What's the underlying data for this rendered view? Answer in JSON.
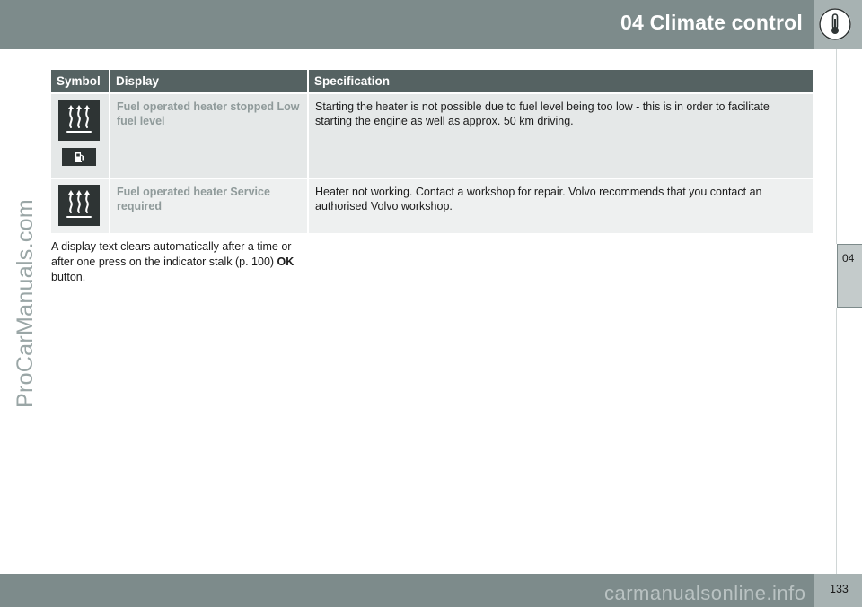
{
  "header": {
    "title": "04 Climate control",
    "icon": "thermometer-icon"
  },
  "side_tab": {
    "label": "04"
  },
  "watermarks": {
    "vertical": "ProCarManuals.com",
    "bottom": "carmanualsonline.info"
  },
  "table": {
    "headers": [
      "Symbol",
      "Display",
      "Specification"
    ],
    "rows": [
      {
        "symbols": [
          "heater-icon",
          "fuel-pump-icon"
        ],
        "display": "Fuel operated heater stopped Low fuel level",
        "specification": "Starting the heater is not possible due to fuel level being too low - this is in order to facilitate starting the engine as well as approx. 50 km driving."
      },
      {
        "symbols": [
          "heater-icon"
        ],
        "display": "Fuel operated heater Service required",
        "specification": "Heater not working. Contact a workshop for repair. Volvo recommends that you contact an authorised Volvo workshop."
      }
    ]
  },
  "note": {
    "text_before": "A display text clears automatically after a time or after one press on the indicator stalk (p. 100) ",
    "bold": "OK",
    "text_after": " button."
  },
  "footer": {
    "page_number": "133"
  }
}
